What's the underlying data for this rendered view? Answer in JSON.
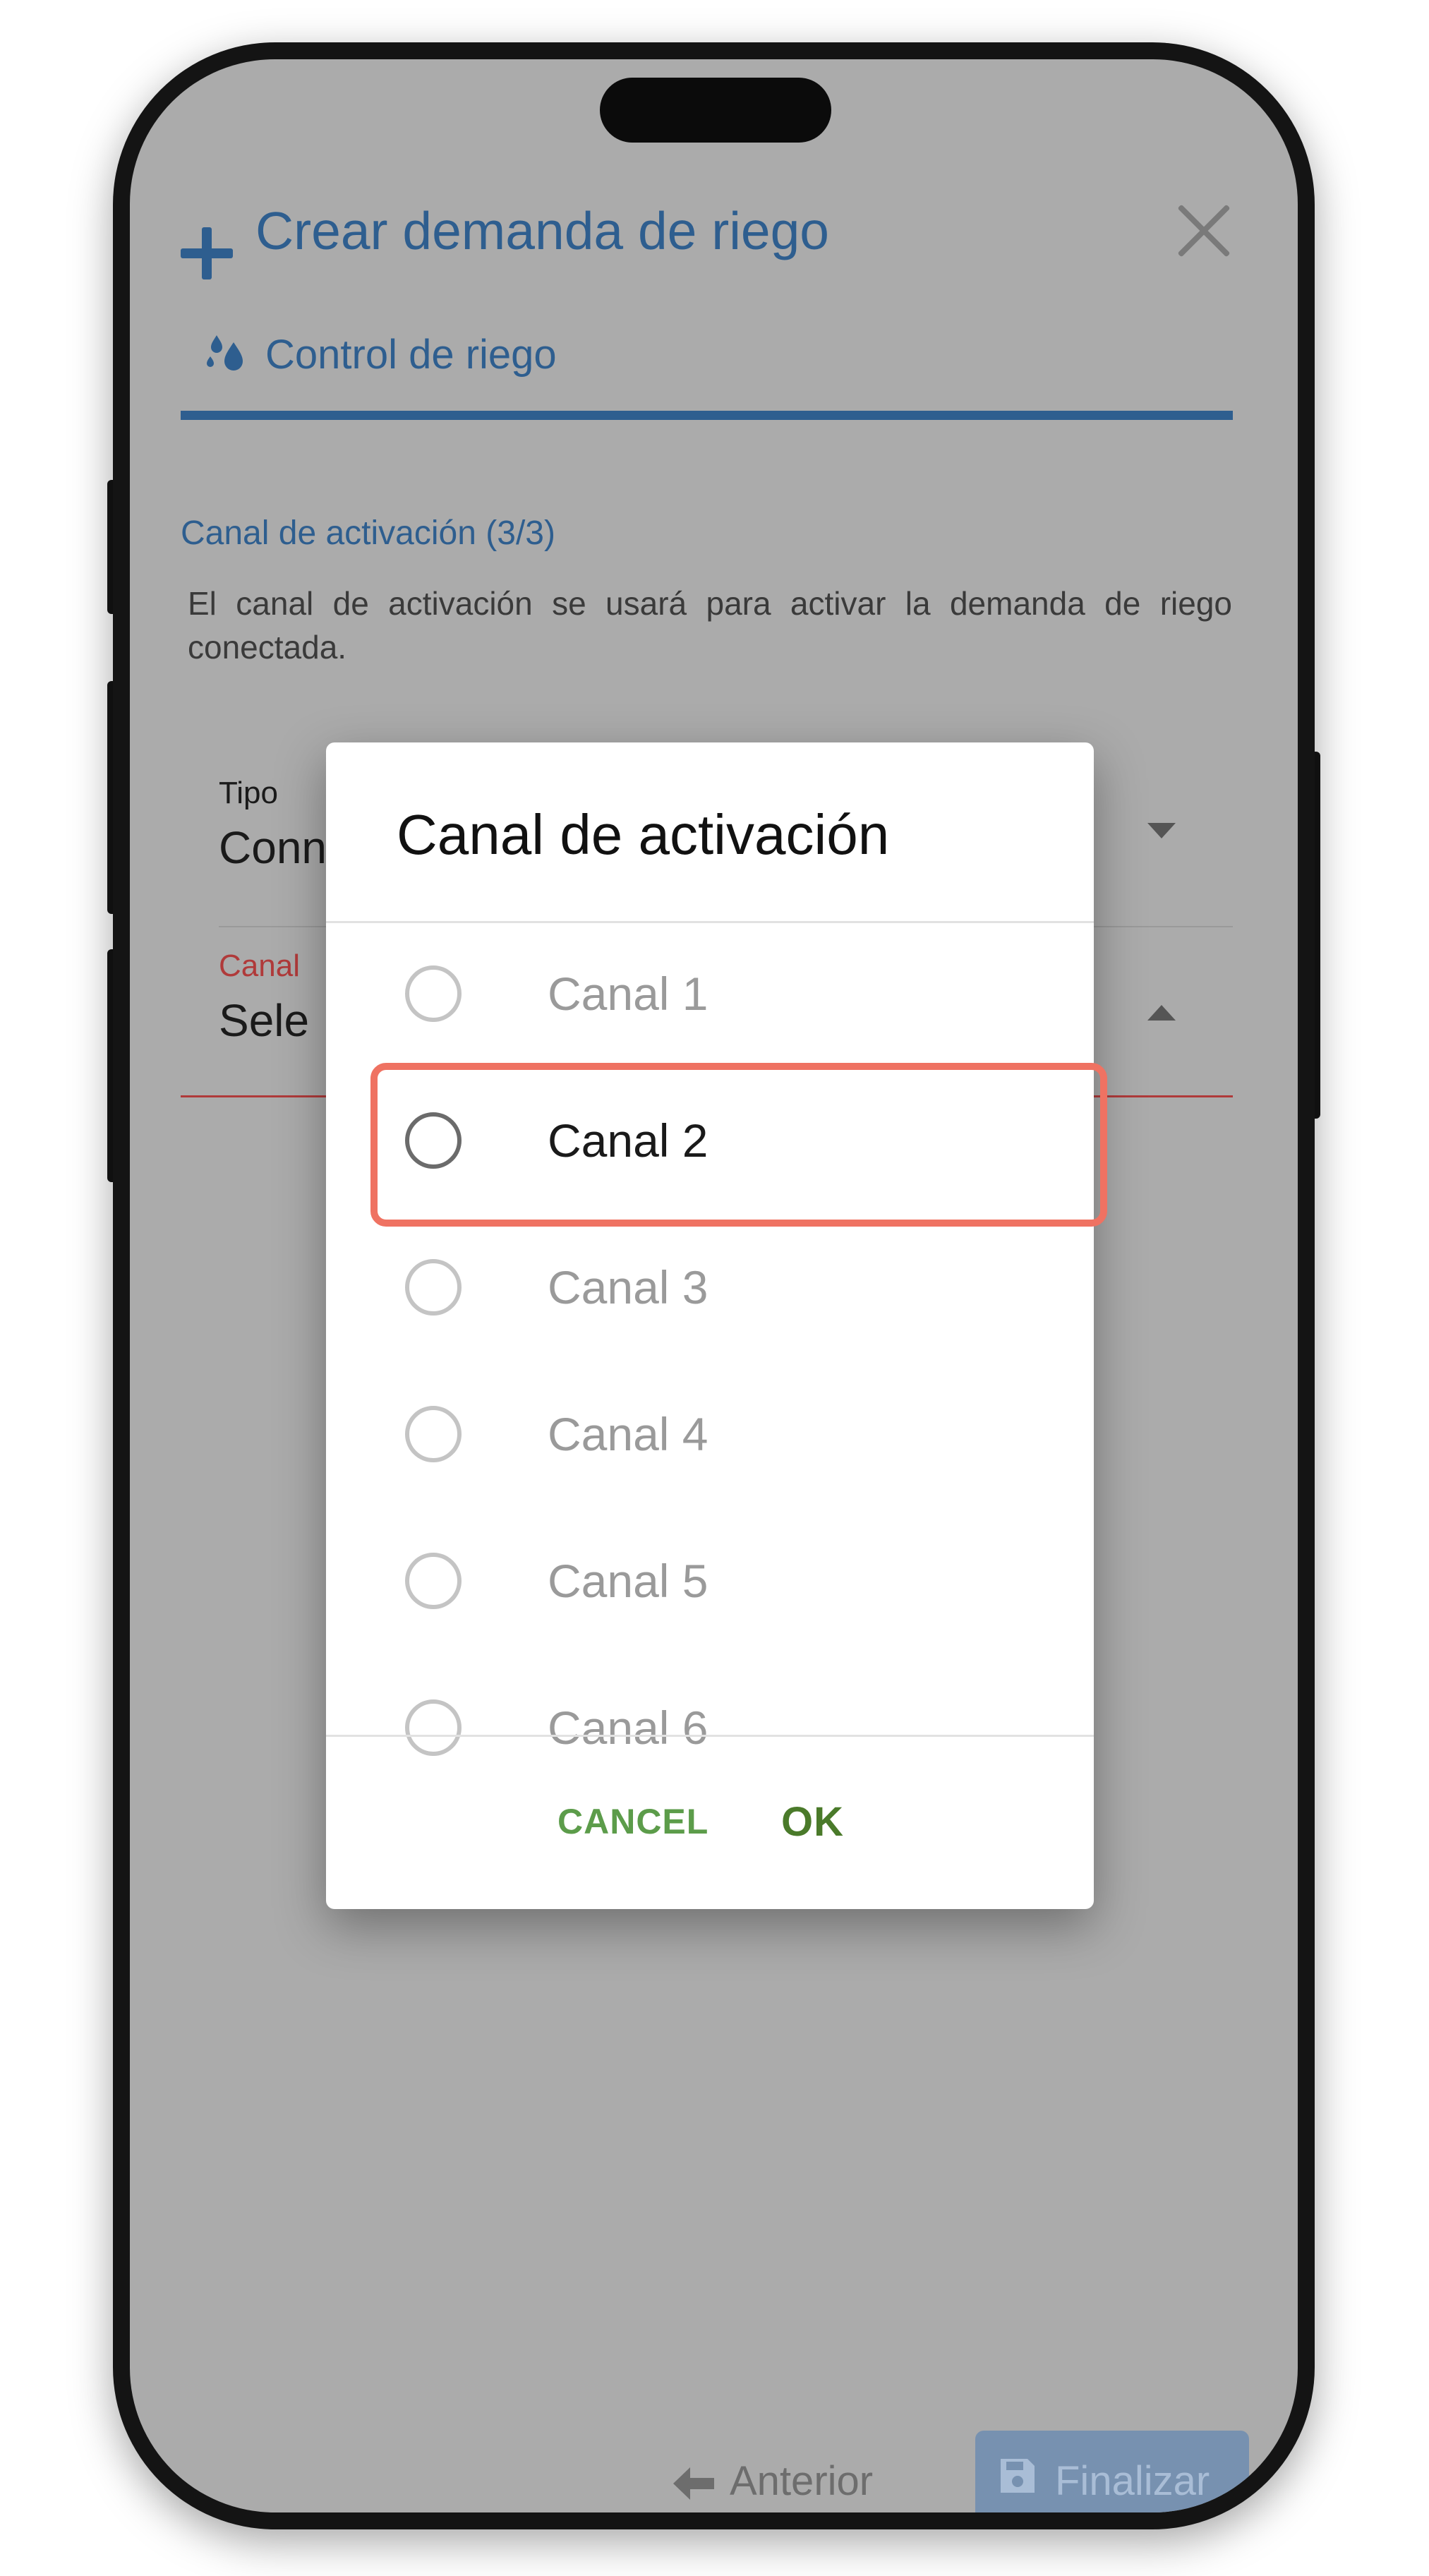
{
  "form": {
    "title": "Crear demanda de riego",
    "tab_label": "Control de riego",
    "section_title": "Canal de activación (3/3)",
    "description": "El canal de activación se usará para activar la demanda de riego conectada.",
    "field_tipo": {
      "label": "Tipo",
      "value": "Conn"
    },
    "field_canal": {
      "label": "Canal",
      "value": "Sele"
    },
    "prev_label": "Anterior",
    "finish_label": "Finalizar"
  },
  "dialog": {
    "title": "Canal de activación",
    "options": [
      {
        "label": "Canal 1",
        "selected": false
      },
      {
        "label": "Canal 2",
        "selected": false
      },
      {
        "label": "Canal 3",
        "selected": false
      },
      {
        "label": "Canal 4",
        "selected": false
      },
      {
        "label": "Canal 5",
        "selected": false
      },
      {
        "label": "Canal 6",
        "selected": false
      }
    ],
    "cancel_label": "CANCEL",
    "ok_label": "OK"
  },
  "colors": {
    "primary_blue": "#2e5e8f",
    "error_red": "#b03a3a",
    "cancel_green": "#5c9c4a",
    "ok_green": "#4a7a2a",
    "highlight": "#ef7262"
  },
  "icons": [
    "plus-icon",
    "close-icon",
    "water-drops-icon",
    "caret-down-icon",
    "caret-up-icon",
    "arrow-left-icon",
    "save-icon",
    "radio-icon"
  ]
}
